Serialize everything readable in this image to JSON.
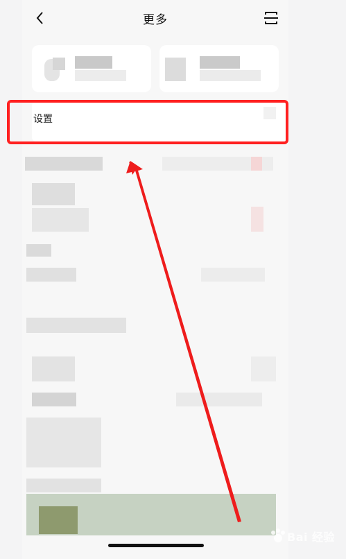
{
  "header": {
    "title": "更多",
    "back_icon": "chevron-left-icon",
    "scan_icon": "scan-icon"
  },
  "settings": {
    "label": "设置"
  },
  "watermark": {
    "text": "Bai 经验"
  },
  "colors": {
    "highlight": "#ff2020",
    "arrow": "#ee1c1c",
    "background": "#f7f7f7"
  }
}
